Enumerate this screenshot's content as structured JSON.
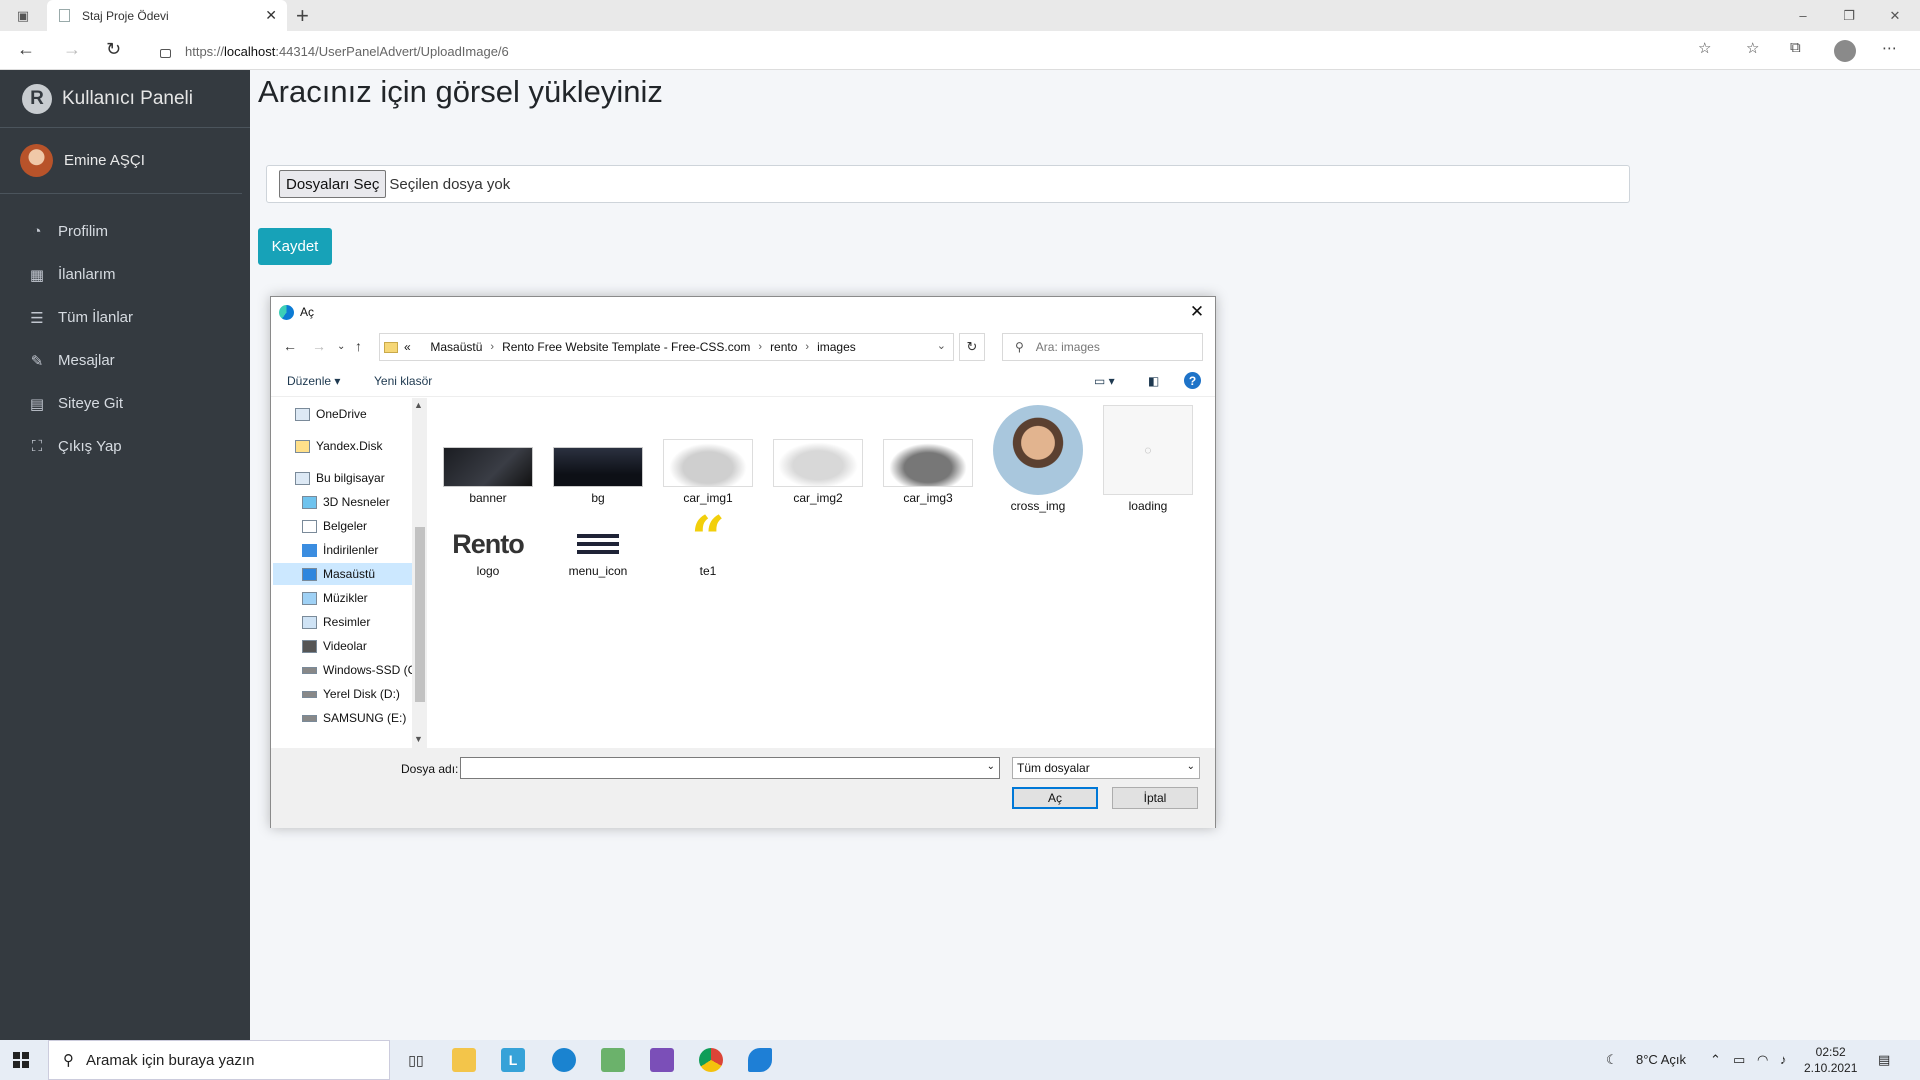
{
  "browser": {
    "tab_title": "Staj Proje Ödevi",
    "url_prefix": "https://",
    "url_host": "localhost",
    "url_rest": ":44314/UserPanelAdvert/UploadImage/6"
  },
  "sidebar": {
    "brand": "Kullanıcı Paneli",
    "user_name": "Emine AŞÇI",
    "items": [
      {
        "label": "Profilim",
        "icon": "dashboard-icon"
      },
      {
        "label": "İlanlarım",
        "icon": "grid-icon"
      },
      {
        "label": "Tüm İlanlar",
        "icon": "list-icon"
      },
      {
        "label": "Mesajlar",
        "icon": "edit-icon"
      },
      {
        "label": "Siteye Git",
        "icon": "list-alt-icon"
      },
      {
        "label": "Çıkış Yap",
        "icon": "user-exit-icon"
      }
    ]
  },
  "main": {
    "title": "Aracınız için görsel yükleyiniz",
    "file_button": "Dosyaları Seç",
    "file_none": "Seçilen dosya yok",
    "save_label": "Kaydet"
  },
  "dialog": {
    "title": "Aç",
    "breadcrumb": [
      "«",
      "Masaüstü",
      "Rento Free Website Template - Free-CSS.com",
      "rento",
      "images"
    ],
    "search_placeholder": "Ara: images",
    "organize": "Düzenle",
    "new_folder": "Yeni klasör",
    "tree": [
      {
        "label": "OneDrive"
      },
      {
        "label": "Yandex.Disk"
      },
      {
        "label": "Bu bilgisayar"
      },
      {
        "label": "3D Nesneler"
      },
      {
        "label": "Belgeler"
      },
      {
        "label": "İndirilenler"
      },
      {
        "label": "Masaüstü",
        "selected": true
      },
      {
        "label": "Müzikler"
      },
      {
        "label": "Resimler"
      },
      {
        "label": "Videolar"
      },
      {
        "label": "Windows-SSD (C"
      },
      {
        "label": "Yerel Disk (D:)"
      },
      {
        "label": "SAMSUNG (E:)"
      }
    ],
    "files": [
      {
        "name": "banner"
      },
      {
        "name": "bg"
      },
      {
        "name": "car_img1"
      },
      {
        "name": "car_img2"
      },
      {
        "name": "car_img3"
      },
      {
        "name": "cross_img"
      },
      {
        "name": "loading"
      },
      {
        "name": "logo",
        "text": "Rento"
      },
      {
        "name": "menu_icon"
      },
      {
        "name": "te1"
      }
    ],
    "filename_label": "Dosya adı:",
    "filename_value": "",
    "filetype": "Tüm dosyalar",
    "open_label": "Aç",
    "cancel_label": "İptal"
  },
  "taskbar": {
    "search_placeholder": "Aramak için buraya yazın",
    "weather": "8°C  Açık",
    "time": "02:52",
    "date": "2.10.2021"
  },
  "colors": {
    "sidebar_bg": "#343a40",
    "accent": "#17a2b8",
    "dialog_selection": "#cce8ff"
  }
}
